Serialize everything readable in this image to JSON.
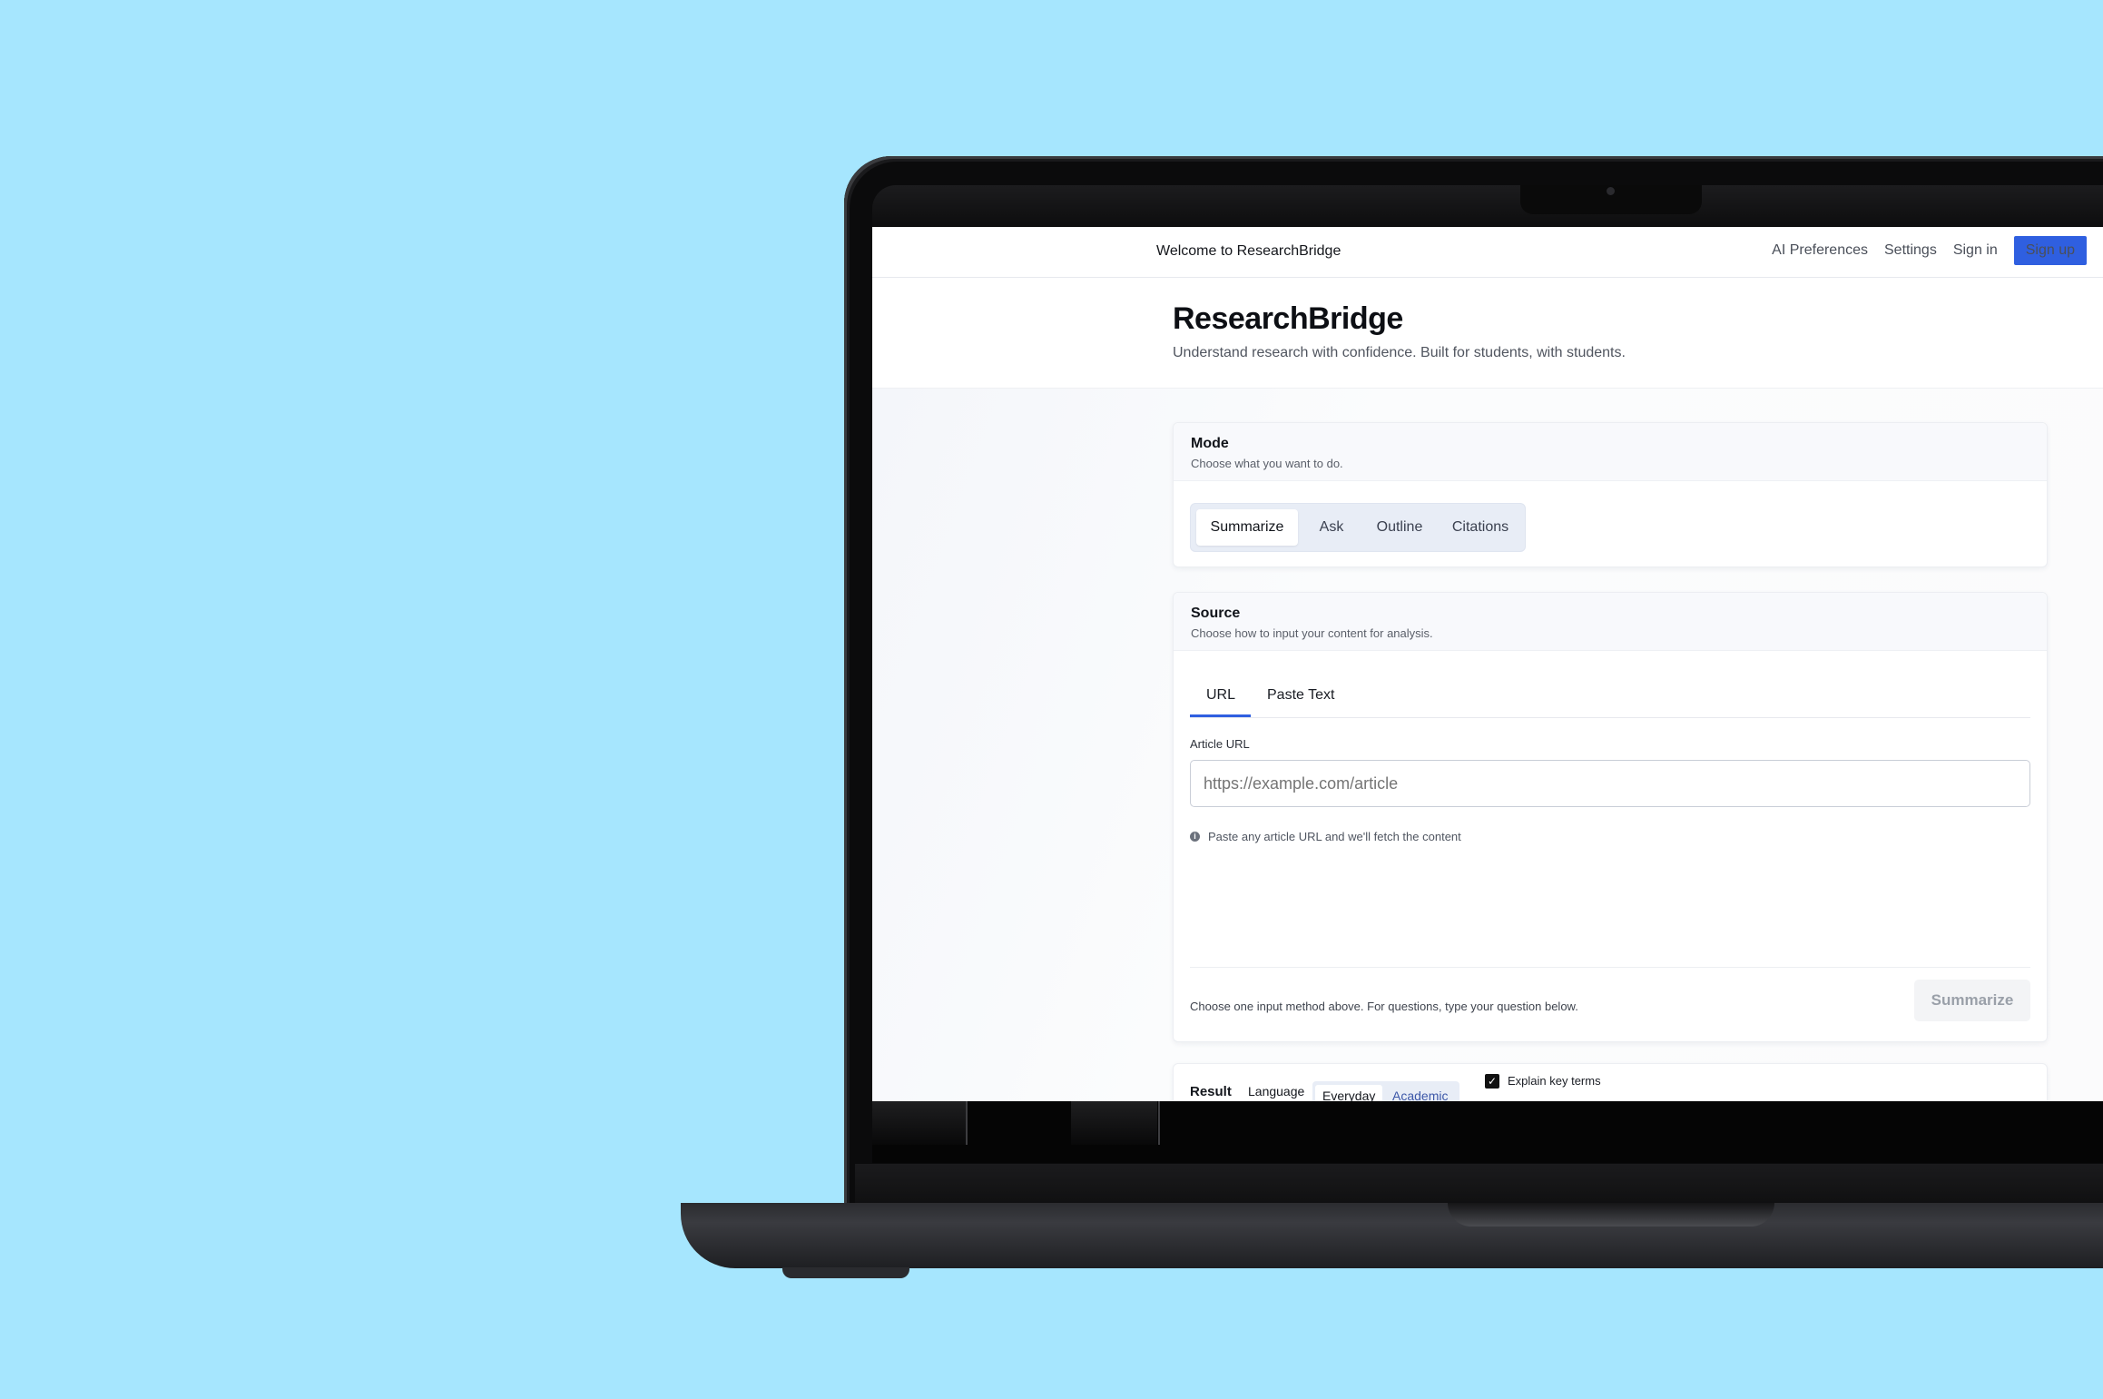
{
  "topbar": {
    "welcome": "Welcome to ResearchBridge",
    "nav": {
      "ai_preferences": "AI Preferences",
      "settings": "Settings",
      "sign_in": "Sign in",
      "sign_up": "Sign up"
    }
  },
  "hero": {
    "brand": "ResearchBridge",
    "tagline": "Understand research with confidence. Built for students, with students."
  },
  "mode": {
    "title": "Mode",
    "subtitle": "Choose what you want to do.",
    "options": [
      "Summarize",
      "Ask",
      "Outline",
      "Citations"
    ],
    "selected": "Summarize"
  },
  "source": {
    "title": "Source",
    "subtitle": "Choose how to input your content for analysis.",
    "tabs": [
      "URL",
      "Paste Text"
    ],
    "active_tab": "URL",
    "field_label": "Article URL",
    "url_placeholder": "https://example.com/article",
    "url_value": "",
    "hint": "Paste any article URL and we'll fetch the content",
    "footer_note": "Choose one input method above. For questions, type your question below.",
    "submit_label": "Summarize"
  },
  "result": {
    "title": "Result",
    "language_label": "Language",
    "language_options": [
      "Everyday",
      "Academic"
    ],
    "language_selected": "Everyday",
    "explain_terms_label": "Explain key terms",
    "explain_terms_checked": true
  },
  "colors": {
    "background": "#a6e6fe",
    "accent": "#2f5fe0"
  }
}
